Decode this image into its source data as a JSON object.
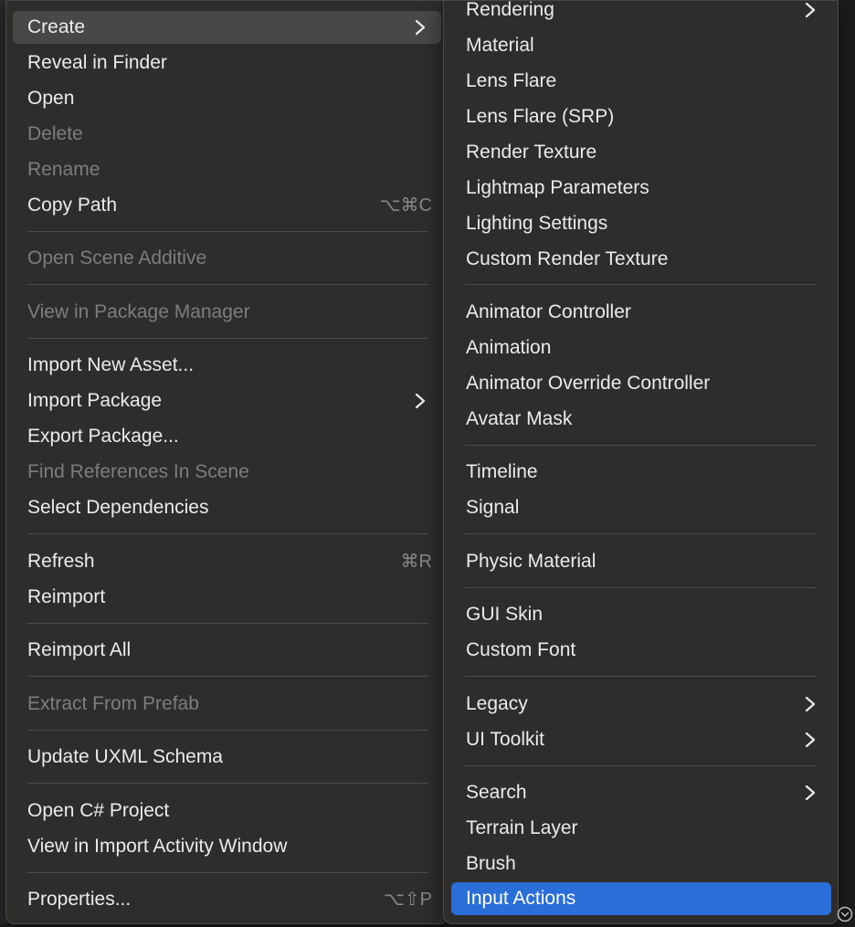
{
  "left_menu": {
    "create": "Create",
    "reveal_in_finder": "Reveal in Finder",
    "open": "Open",
    "delete": "Delete",
    "rename": "Rename",
    "copy_path": "Copy Path",
    "copy_path_shortcut": "⌥⌘C",
    "open_scene_additive": "Open Scene Additive",
    "view_in_package_manager": "View in Package Manager",
    "import_new_asset": "Import New Asset...",
    "import_package": "Import Package",
    "export_package": "Export Package...",
    "find_references_in_scene": "Find References In Scene",
    "select_dependencies": "Select Dependencies",
    "refresh": "Refresh",
    "refresh_shortcut": "⌘R",
    "reimport": "Reimport",
    "reimport_all": "Reimport All",
    "extract_from_prefab": "Extract From Prefab",
    "update_uxml_schema": "Update UXML Schema",
    "open_csharp_project": "Open C# Project",
    "view_in_import_activity_window": "View in Import Activity Window",
    "properties": "Properties...",
    "properties_shortcut": "⌥⇧P"
  },
  "right_menu": {
    "rendering": "Rendering",
    "material": "Material",
    "lens_flare": "Lens Flare",
    "lens_flare_srp": "Lens Flare (SRP)",
    "render_texture": "Render Texture",
    "lightmap_parameters": "Lightmap Parameters",
    "lighting_settings": "Lighting Settings",
    "custom_render_texture": "Custom Render Texture",
    "animator_controller": "Animator Controller",
    "animation": "Animation",
    "animator_override_controller": "Animator Override Controller",
    "avatar_mask": "Avatar Mask",
    "timeline": "Timeline",
    "signal": "Signal",
    "physic_material": "Physic Material",
    "gui_skin": "GUI Skin",
    "custom_font": "Custom Font",
    "legacy": "Legacy",
    "ui_toolkit": "UI Toolkit",
    "search": "Search",
    "terrain_layer": "Terrain Layer",
    "brush": "Brush",
    "input_actions": "Input Actions"
  },
  "colors": {
    "menu_bg": "#2f2d2b",
    "hover_bg": "#4a4846",
    "selected_bg": "#2a6ed8",
    "text": "#ecebea",
    "disabled_text": "#7f7d7b"
  }
}
